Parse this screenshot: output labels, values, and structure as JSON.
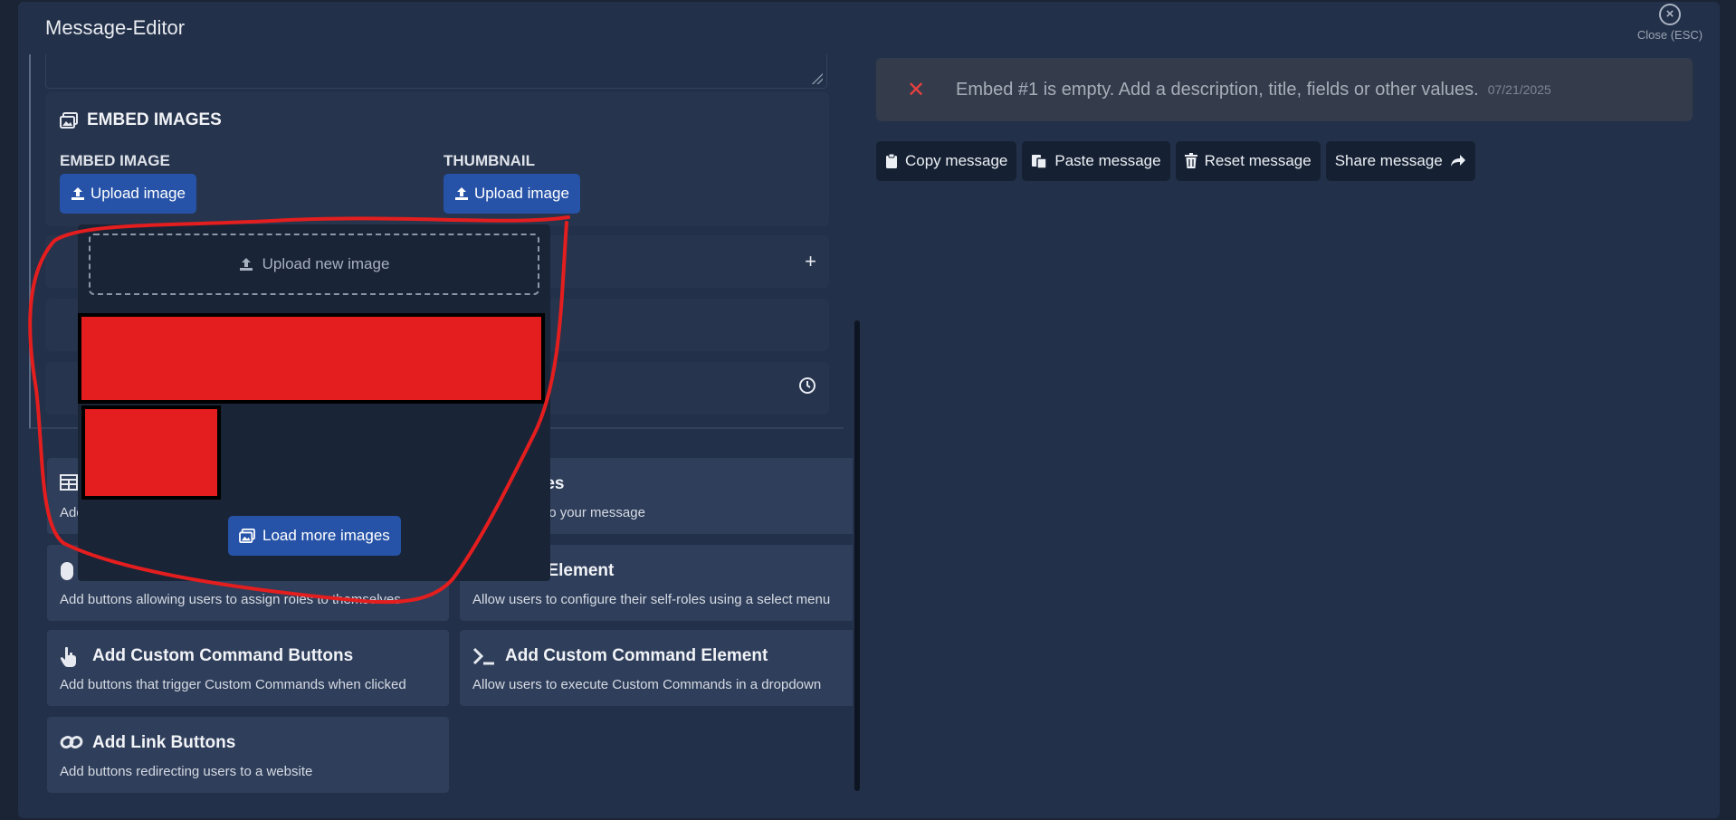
{
  "modal": {
    "title": "Message-Editor",
    "close_label": "Close (ESC)"
  },
  "embed_images": {
    "title": "EMBED IMAGES",
    "embed_image_label": "EMBED IMAGE",
    "thumbnail_label": "THUMBNAIL",
    "upload_label": "Upload image"
  },
  "image_picker": {
    "upload_new_label": "Upload new image",
    "load_more_label": "Load more images",
    "thumbnail_color": "#e41e1e"
  },
  "tiles": [
    {
      "title": "images",
      "desc": "five images to your message",
      "icon": "images-icon"
    },
    {
      "title": "Role Element",
      "desc": "Allow users to configure their self-roles using a select menu",
      "icon": "role-icon"
    },
    {
      "title": "",
      "desc": "Add buttons allowing users to assign roles to themselves",
      "icon": "mouse-icon"
    },
    {
      "title": "Add Custom Command Buttons",
      "desc": "Add buttons that trigger Custom Commands when clicked",
      "icon": "pointer-hand-icon"
    },
    {
      "title": "Add Custom Command Element",
      "desc": "Allow users to execute Custom Commands in a dropdown",
      "icon": "terminal-icon"
    },
    {
      "title": "Add Link Buttons",
      "desc": "Add buttons redirecting users to a website",
      "icon": "link-icon"
    }
  ],
  "tile_partial_desc": "Add",
  "alert": {
    "message": "Embed #1 is empty. Add a description, title, fields or other values.",
    "date": "07/21/2025",
    "color": "#e84040"
  },
  "actions": {
    "copy": "Copy message",
    "paste": "Paste message",
    "reset": "Reset message",
    "share": "Share message"
  },
  "colors": {
    "accent": "#2653a8",
    "annotation": "#e41e1e"
  }
}
